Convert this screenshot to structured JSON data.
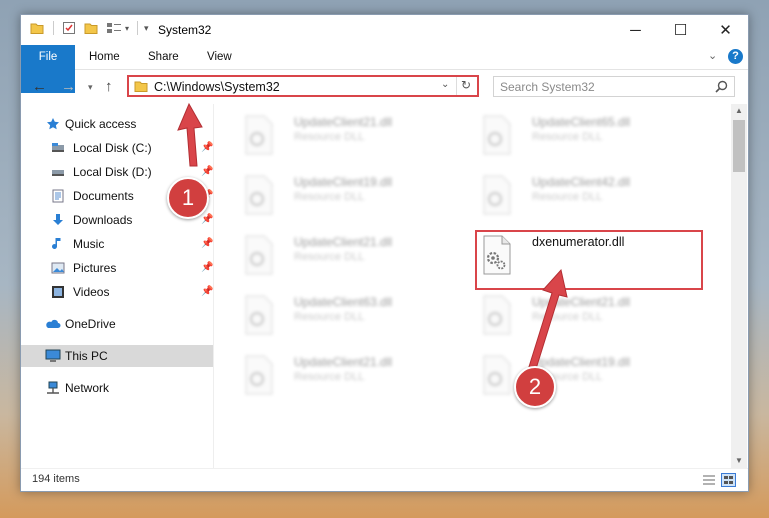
{
  "window": {
    "title": "System32"
  },
  "ribbon": {
    "tabs": [
      "File",
      "Home",
      "Share",
      "View"
    ]
  },
  "address": {
    "path": "C:\\Windows\\System32"
  },
  "search": {
    "placeholder": "Search System32"
  },
  "sidebar": {
    "items": [
      {
        "label": "Quick access",
        "icon": "star-icon"
      },
      {
        "label": "Local Disk (C:)",
        "icon": "drive-icon",
        "pinned": true
      },
      {
        "label": "Local Disk (D:)",
        "icon": "drive-icon",
        "pinned": true
      },
      {
        "label": "Documents",
        "icon": "documents-icon",
        "pinned": true
      },
      {
        "label": "Downloads",
        "icon": "downloads-icon",
        "pinned": true
      },
      {
        "label": "Music",
        "icon": "music-icon",
        "pinned": true
      },
      {
        "label": "Pictures",
        "icon": "pictures-icon",
        "pinned": true
      },
      {
        "label": "Videos",
        "icon": "videos-icon",
        "pinned": true
      },
      {
        "label": "OneDrive",
        "icon": "onedrive-icon"
      },
      {
        "label": "This PC",
        "icon": "computer-icon",
        "selected": true
      },
      {
        "label": "Network",
        "icon": "network-icon"
      }
    ]
  },
  "files": [
    {
      "name": "UpdateClient21.dll",
      "type": "Resource DLL",
      "blurred": true
    },
    {
      "name": "UpdateClient65.dll",
      "type": "Resource DLL",
      "blurred": true
    },
    {
      "name": "UpdateClient19.dll",
      "type": "Resource DLL",
      "blurred": true
    },
    {
      "name": "UpdateClient42.dll",
      "type": "Resource DLL",
      "blurred": true
    },
    {
      "name": "UpdateClient21.dll",
      "type": "Resource DLL",
      "blurred": true
    },
    {
      "name": "dxenumerator.dll",
      "type": "",
      "blurred": false,
      "highlighted": true
    },
    {
      "name": "UpdateClient63.dll",
      "type": "Resource DLL",
      "blurred": true
    },
    {
      "name": "UpdateClient21.dll",
      "type": "Resource DLL",
      "blurred": true
    },
    {
      "name": "UpdateClient21.dll",
      "type": "Resource DLL",
      "blurred": true
    },
    {
      "name": "UpdateClient19.dll",
      "type": "Resource DLL",
      "blurred": true
    }
  ],
  "status": {
    "item_count": "194 items"
  },
  "annotations": {
    "step1": "1",
    "step2": "2",
    "color": "#d9454a"
  }
}
